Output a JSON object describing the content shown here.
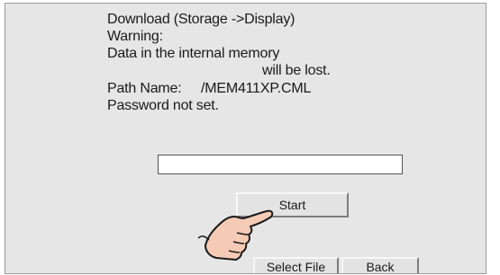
{
  "dialog": {
    "title_line": "Download (Storage ->Display)",
    "warning_label": "Warning:",
    "warning_line1": "Data in the internal memory",
    "warning_line2": "will be lost.",
    "path_label": "Path Name:",
    "path_value": "/MEM411XP.CML",
    "password_status": "Password not set."
  },
  "progress": {
    "value": 0
  },
  "buttons": {
    "start": "Start",
    "select_file": "Select File",
    "back": "Back"
  },
  "icons": {
    "pointer": "pointing-hand-icon"
  }
}
